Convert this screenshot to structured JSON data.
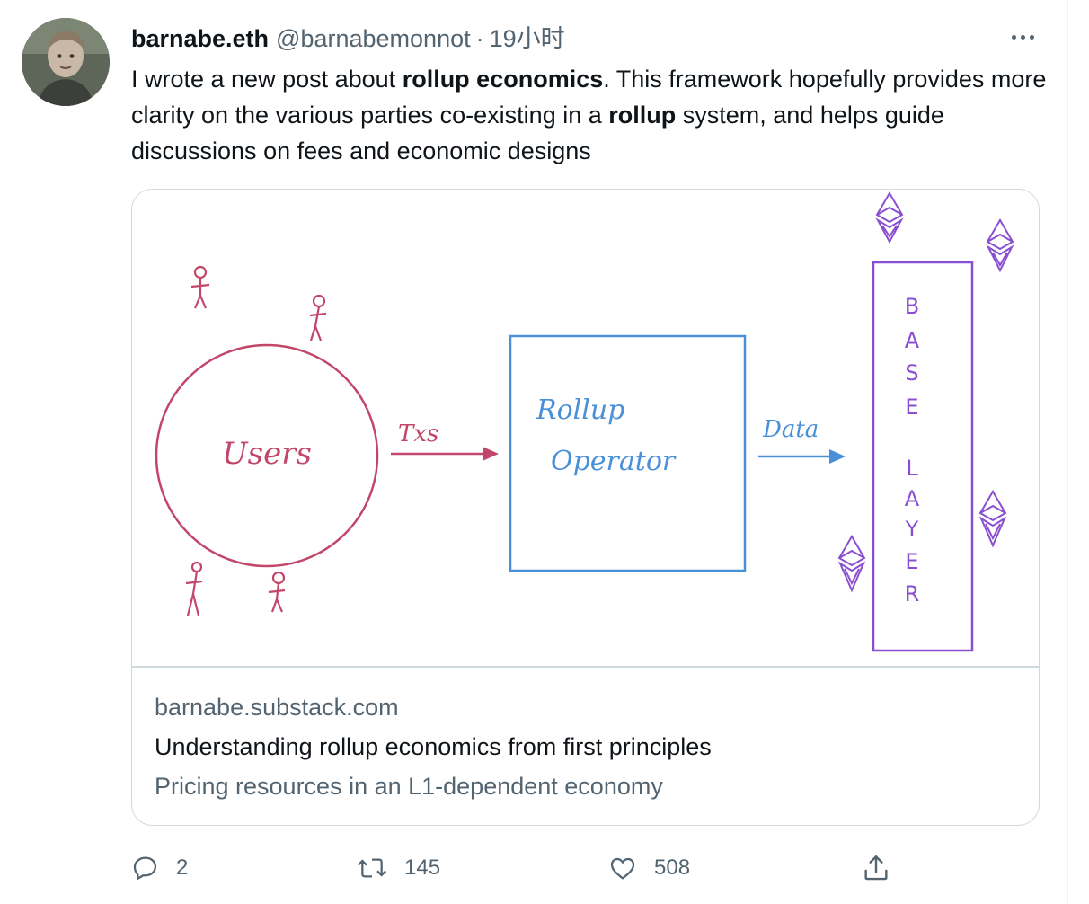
{
  "tweet": {
    "display_name": "barnabe.eth",
    "handle": "@barnabemonnot",
    "separator": "·",
    "timestamp": "19小时",
    "text": {
      "p1": "I wrote a new post about ",
      "b1": "rollup economics",
      "p2": ". This framework hopefully provides more clarity on the various parties co-existing in a ",
      "b2": "rollup",
      "p3": " system, and helps guide discussions on fees and economic designs"
    }
  },
  "card": {
    "diagram": {
      "users_label": "Users",
      "txs_label": "Txs",
      "operator_line1": "Rollup",
      "operator_line2": "Operator",
      "data_label": "Data",
      "base_letters": [
        "B",
        "A",
        "S",
        "E"
      ],
      "layer_letters": [
        "L",
        "A",
        "Y",
        "E",
        "R"
      ],
      "colors": {
        "users": "#c2466a",
        "operator": "#4a90d9",
        "base": "#8a4fd0"
      }
    },
    "domain": "barnabe.substack.com",
    "title": "Understanding rollup economics from first principles",
    "description": "Pricing resources in an L1-dependent economy"
  },
  "actions": {
    "reply_count": "2",
    "retweet_count": "145",
    "like_count": "508",
    "icons": [
      "reply-icon",
      "retweet-icon",
      "like-icon",
      "share-icon"
    ]
  },
  "more_icon": "more-options-icon"
}
